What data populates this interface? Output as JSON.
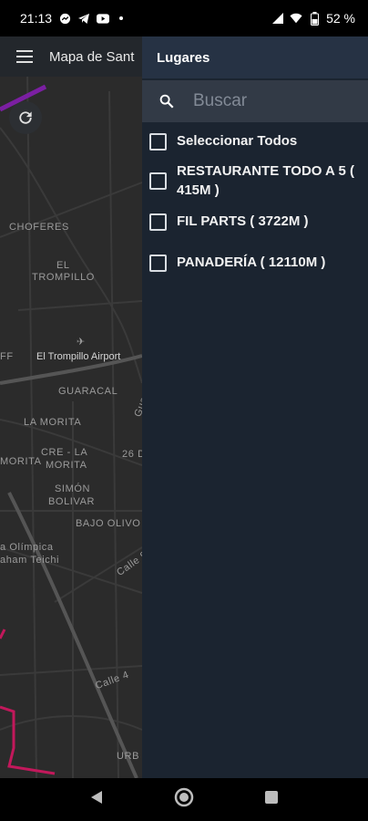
{
  "status_bar": {
    "time": "21:13",
    "battery": "52 %"
  },
  "app_bar": {
    "title": "Mapa de Sant"
  },
  "map": {
    "labels": [
      "CHOFERES",
      "EL",
      "TROMPILLO",
      "El Trompillo Airport",
      "GUARACAL",
      "LA MORITA",
      "MORITA",
      "CRE - LA",
      "MORITA",
      "SIMÓN",
      "BOLIVAR",
      "BAJO OLIVO",
      "a Olímpica",
      "aham Teichi",
      "26 D",
      "Calle 9",
      "Calle 4",
      "URB",
      "Guarac",
      "FF"
    ]
  },
  "drawer": {
    "title": "Lugares",
    "search_placeholder": "Buscar",
    "items": [
      {
        "label": "Seleccionar Todos"
      },
      {
        "label": "RESTAURANTE TODO A 5 ( 415M )"
      },
      {
        "label": "FIL PARTS ( 3722M )"
      },
      {
        "label": "PANADERÍA ( 12110M )"
      }
    ]
  },
  "colors": {
    "drawer_bg": "#1b2430",
    "drawer_header": "#263244",
    "route": "#c2185b"
  }
}
